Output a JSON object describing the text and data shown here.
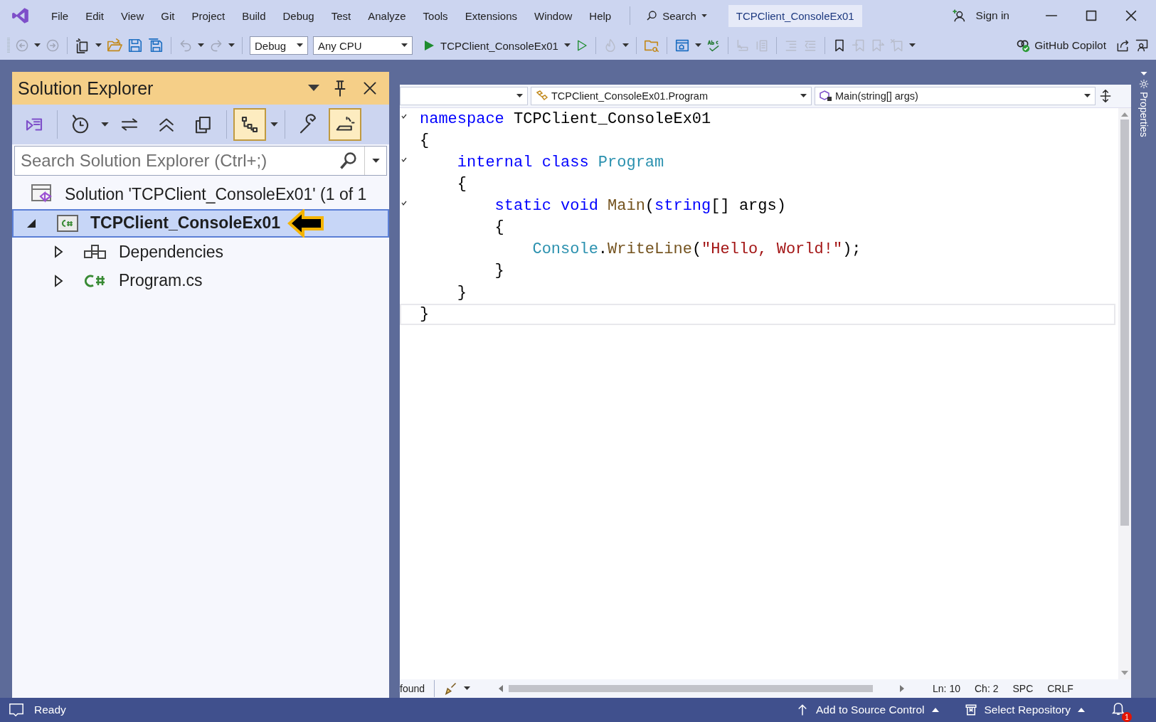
{
  "menu": [
    "File",
    "Edit",
    "View",
    "Git",
    "Project",
    "Build",
    "Debug",
    "Test",
    "Analyze",
    "Tools",
    "Extensions",
    "Window",
    "Help"
  ],
  "search": {
    "label": "Search"
  },
  "window_title": "TCPClient_ConsoleEx01",
  "sign_in": "Sign in",
  "toolbar": {
    "configuration": "Debug",
    "platform": "Any CPU",
    "start_target": "TCPClient_ConsoleEx01",
    "copilot": "GitHub Copilot"
  },
  "solution_explorer": {
    "title": "Solution Explorer",
    "tools": [
      {
        "kind": "vs-switch",
        "on": false
      },
      {
        "kind": "history",
        "on": false
      },
      {
        "kind": "sync",
        "on": false
      },
      {
        "kind": "collapse",
        "on": false
      },
      {
        "kind": "copy",
        "on": false
      },
      {
        "kind": "tree-view",
        "on": true
      },
      {
        "kind": "wrench",
        "on": false
      },
      {
        "kind": "preview",
        "on": true
      }
    ],
    "search": {
      "placeholder": "Search Solution Explorer (Ctrl+;)"
    },
    "tree": [
      {
        "label": "Solution 'TCPClient_ConsoleEx01' (1 of 1",
        "kind": "solution",
        "selected": false,
        "children": [
          {
            "label": "TCPClient_ConsoleEx01",
            "kind": "project",
            "selected": true,
            "expanded": true,
            "children": [
              {
                "label": "Dependencies",
                "kind": "dependencies",
                "selected": false,
                "expanded": false
              },
              {
                "label": "Program.cs",
                "kind": "csharp-file",
                "selected": false,
                "expanded": false
              }
            ]
          }
        ]
      }
    ]
  },
  "editor": {
    "nav": [
      "TCPClient_ConsoleEx01.Program",
      "Main(string[] args)"
    ],
    "lines": [
      {
        "fold": true,
        "tokens": [
          {
            "text": "namespace ",
            "kind": "keyword"
          },
          {
            "text": "TCPClient_ConsoleEx01",
            "kind": "plain"
          }
        ]
      },
      {
        "fold": false,
        "tokens": [
          {
            "text": "{",
            "kind": "plain"
          }
        ]
      },
      {
        "fold": true,
        "tokens": [
          {
            "text": "    internal class ",
            "kind": "keyword"
          },
          {
            "text": "Program",
            "kind": "type"
          }
        ]
      },
      {
        "fold": false,
        "tokens": [
          {
            "text": "    {",
            "kind": "plain"
          }
        ]
      },
      {
        "fold": true,
        "tokens": [
          {
            "text": "        static void ",
            "kind": "keyword"
          },
          {
            "text": "Main",
            "kind": "method"
          },
          {
            "text": "(",
            "kind": "plain"
          },
          {
            "text": "string",
            "kind": "keyword"
          },
          {
            "text": "[] args)",
            "kind": "plain"
          }
        ]
      },
      {
        "fold": false,
        "tokens": [
          {
            "text": "        {",
            "kind": "plain"
          }
        ]
      },
      {
        "fold": false,
        "tokens": [
          {
            "text": "            Console",
            "kind": "type"
          },
          {
            "text": ".",
            "kind": "plain"
          },
          {
            "text": "WriteLine",
            "kind": "method"
          },
          {
            "text": "(",
            "kind": "plain"
          },
          {
            "text": "\"Hello, World!\"",
            "kind": "string"
          },
          {
            "text": ");",
            "kind": "plain"
          }
        ]
      },
      {
        "fold": false,
        "tokens": [
          {
            "text": "        }",
            "kind": "plain"
          }
        ]
      },
      {
        "fold": false,
        "tokens": [
          {
            "text": "    }",
            "kind": "plain"
          }
        ]
      },
      {
        "fold": false,
        "current": true,
        "tokens": [
          {
            "text": "}",
            "kind": "plain"
          }
        ]
      }
    ],
    "status": {
      "issues": "found",
      "position": [
        "Ln: 10",
        "Ch: 2",
        "SPC",
        "CRLF"
      ]
    }
  },
  "properties_tab": "Properties",
  "status_bar": {
    "message": "Ready",
    "source_control": "Add to Source Control",
    "repository": "Select Repository",
    "notifications": "1"
  }
}
